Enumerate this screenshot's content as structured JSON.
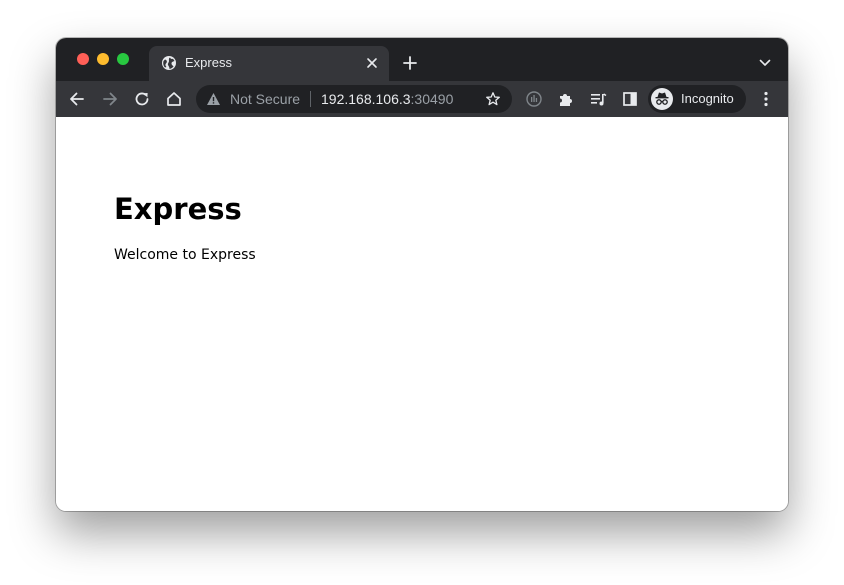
{
  "browser": {
    "tab": {
      "title": "Express"
    },
    "omnibox": {
      "security_label": "Not Secure",
      "url_host": "192.168.106.3",
      "url_port": ":30490"
    },
    "profile": {
      "label": "Incognito"
    },
    "colors": {
      "frame": "#202124",
      "toolbar": "#35363a",
      "close": "#ff5f57",
      "minimize": "#febc2e",
      "maximize": "#28c840"
    }
  },
  "page": {
    "heading": "Express",
    "text": "Welcome to Express"
  }
}
